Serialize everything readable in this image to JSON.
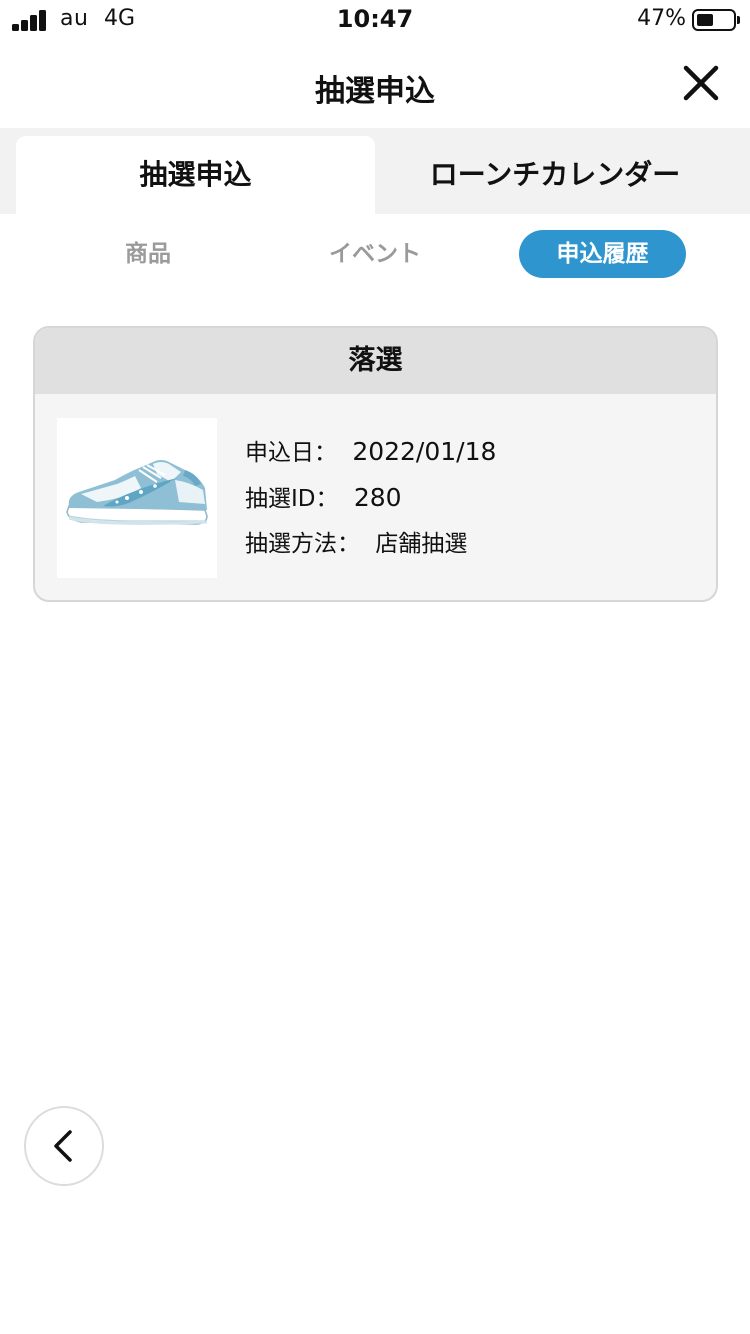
{
  "status_bar": {
    "carrier": "au",
    "network": "4G",
    "time": "10:47",
    "battery_percent": "47%",
    "battery_level": 0.47,
    "signal_icon": "cellular-signal-icon",
    "battery_icon": "battery-icon"
  },
  "header": {
    "title": "抽選申込",
    "close_icon": "close-icon"
  },
  "top_tabs": [
    {
      "label": "抽選申込",
      "active": true
    },
    {
      "label": "ローンチカレンダー",
      "active": false
    }
  ],
  "sub_tabs": [
    {
      "label": "商品",
      "active": false
    },
    {
      "label": "イベント",
      "active": false
    },
    {
      "label": "申込履歴",
      "active": true
    }
  ],
  "entry": {
    "status": "落選",
    "image_icon": "sneaker-image",
    "date_label": "申込日：",
    "date_value": "2022/01/18",
    "id_label": "抽選ID：",
    "id_value": "280",
    "method_label": "抽選方法：",
    "method_value": "店舗抽選"
  },
  "nav": {
    "back_icon": "chevron-left-icon"
  },
  "colors": {
    "accent": "#2e95cf",
    "tab_bar_bg": "#f2f2f2",
    "card_head_bg": "#e0e0e0",
    "card_bg": "#f5f5f5",
    "inactive_text": "#9a9a9a"
  }
}
